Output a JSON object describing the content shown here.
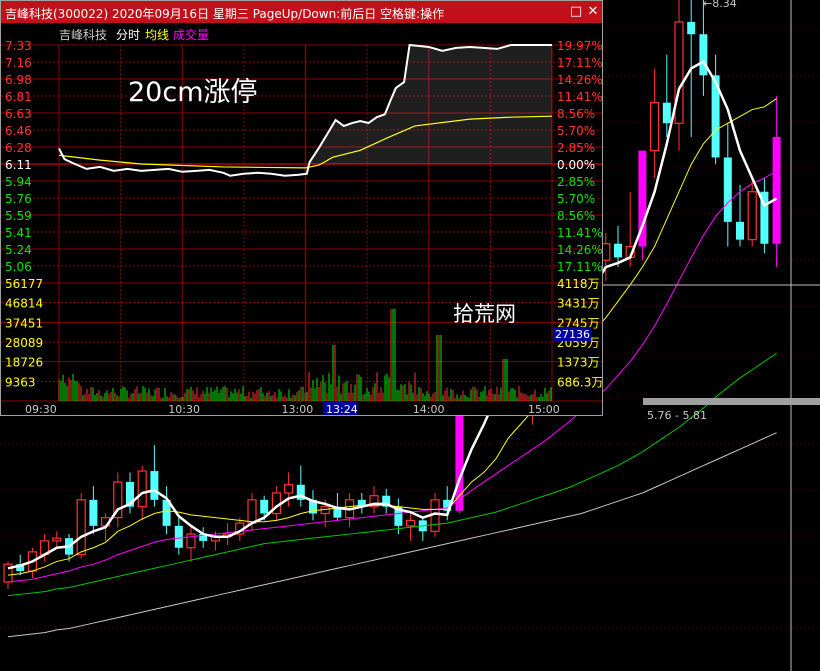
{
  "window": {
    "title": "吉峰科技(300022) 2020年09月16日 星期三 PageUp/Down:前后日 空格键:操作",
    "min_icon": "minimize-icon",
    "close_icon": "close-icon"
  },
  "minute_chart": {
    "stock_name": "吉峰科技",
    "tab_minute": "分时",
    "legend_avg": "均线",
    "legend_vol": "成交量",
    "annotation": "20cm涨停",
    "watermark": "拾荒网",
    "price_labels_up": [
      "7.33",
      "7.16",
      "6.98",
      "6.81",
      "6.63",
      "6.46",
      "6.28"
    ],
    "price_label_mid": "6.11",
    "price_labels_down": [
      "5.94",
      "5.76",
      "5.59",
      "5.41",
      "5.24",
      "5.06"
    ],
    "pct_labels_up": [
      "19.97%",
      "17.11%",
      "14.26%",
      "11.41%",
      "8.56%",
      "5.70%",
      "2.85%"
    ],
    "pct_label_mid": "0.00%",
    "pct_labels_down": [
      "2.85%",
      "5.70%",
      "8.56%",
      "11.41%",
      "14.26%",
      "17.11%"
    ],
    "vol_labels_left": [
      "56177",
      "46814",
      "37451",
      "28089",
      "18726",
      "9363"
    ],
    "vol_labels_right": [
      "4118万",
      "3431万",
      "2745万",
      "2059万",
      "1373万",
      "686.3万"
    ],
    "vol_cursor_value": "27136",
    "time_labels": [
      "09:30",
      "10:30",
      "13:00",
      "14:00",
      "15:00"
    ],
    "cursor_time": "13:24",
    "colors": {
      "up": "#ff3232",
      "down": "#00e600",
      "mid": "#ffffff",
      "price_line": "#ffffff",
      "avg_line": "#ffff00",
      "grid": "#8b0000",
      "cursor_box": "#0000a0"
    },
    "chart_data": {
      "type": "line",
      "prev_close": 6.11,
      "series": [
        {
          "name": "price",
          "points": [
            [
              0,
              6.27
            ],
            [
              4,
              6.16
            ],
            [
              10,
              6.12
            ],
            [
              20,
              6.06
            ],
            [
              30,
              6.08
            ],
            [
              40,
              6.04
            ],
            [
              50,
              6.06
            ],
            [
              60,
              6.04
            ],
            [
              70,
              6.05
            ],
            [
              80,
              6.06
            ],
            [
              90,
              6.03
            ],
            [
              100,
              6.04
            ],
            [
              110,
              6.05
            ],
            [
              120,
              6.02
            ],
            [
              125,
              5.99
            ],
            [
              135,
              6.01
            ],
            [
              145,
              6.02
            ],
            [
              155,
              6.01
            ],
            [
              165,
              5.99
            ],
            [
              175,
              6.0
            ],
            [
              181,
              6.01
            ],
            [
              183,
              6.13
            ],
            [
              190,
              6.28
            ],
            [
              196,
              6.42
            ],
            [
              202,
              6.56
            ],
            [
              208,
              6.5
            ],
            [
              214,
              6.53
            ],
            [
              220,
              6.55
            ],
            [
              226,
              6.53
            ],
            [
              232,
              6.59
            ],
            [
              238,
              6.62
            ],
            [
              242,
              6.76
            ],
            [
              246,
              6.89
            ],
            [
              252,
              6.95
            ],
            [
              256,
              7.33
            ],
            [
              270,
              7.31
            ],
            [
              280,
              7.27
            ],
            [
              290,
              7.3
            ],
            [
              300,
              7.31
            ],
            [
              310,
              7.3
            ],
            [
              320,
              7.29
            ],
            [
              330,
              7.33
            ],
            [
              345,
              7.33
            ],
            [
              360,
              7.33
            ]
          ]
        },
        {
          "name": "avg",
          "points": [
            [
              0,
              6.2
            ],
            [
              30,
              6.15
            ],
            [
              60,
              6.11
            ],
            [
              120,
              6.08
            ],
            [
              180,
              6.07
            ],
            [
              190,
              6.1
            ],
            [
              200,
              6.18
            ],
            [
              220,
              6.25
            ],
            [
              240,
              6.38
            ],
            [
              260,
              6.5
            ],
            [
              300,
              6.57
            ],
            [
              330,
              6.59
            ],
            [
              360,
              6.6
            ]
          ]
        }
      ],
      "ylim": [
        4.89,
        7.33
      ],
      "xlim": [
        0,
        360
      ]
    }
  },
  "kline_chart": {
    "price_cursor_label": "5.76 - 5.81",
    "high_label": "8.34",
    "colors": {
      "up": "#ff3232",
      "down": "#54ffff",
      "limit": "#ff00ff",
      "ma5": "#ffffff",
      "ma10": "#ffff00",
      "ma20": "#ff00ff",
      "ma30": "#00c800",
      "ma60": "#c8c8c8"
    },
    "chart_data": {
      "type": "candlestick",
      "ylim": [
        3.6,
        8.5
      ],
      "candles": [
        [
          4.25,
          4.4,
          4.2,
          4.38
        ],
        [
          4.38,
          4.45,
          4.3,
          4.33
        ],
        [
          4.33,
          4.5,
          4.28,
          4.47
        ],
        [
          4.45,
          4.6,
          4.4,
          4.55
        ],
        [
          4.55,
          4.62,
          4.5,
          4.57
        ],
        [
          4.57,
          4.6,
          4.4,
          4.45
        ],
        [
          4.45,
          4.9,
          4.42,
          4.85
        ],
        [
          4.85,
          4.95,
          4.6,
          4.66
        ],
        [
          4.66,
          4.75,
          4.55,
          4.72
        ],
        [
          4.72,
          5.05,
          4.65,
          4.98
        ],
        [
          4.98,
          5.05,
          4.75,
          4.8
        ],
        [
          4.8,
          5.1,
          4.7,
          5.06
        ],
        [
          5.06,
          5.25,
          4.8,
          4.85
        ],
        [
          4.85,
          4.95,
          4.6,
          4.66
        ],
        [
          4.66,
          4.72,
          4.45,
          4.5
        ],
        [
          4.5,
          4.65,
          4.4,
          4.6
        ],
        [
          4.6,
          4.65,
          4.5,
          4.55
        ],
        [
          4.55,
          4.62,
          4.48,
          4.58
        ],
        [
          4.58,
          4.68,
          4.52,
          4.6
        ],
        [
          4.6,
          4.72,
          4.55,
          4.68
        ],
        [
          4.68,
          4.9,
          4.62,
          4.85
        ],
        [
          4.85,
          4.88,
          4.7,
          4.75
        ],
        [
          4.75,
          4.95,
          4.7,
          4.9
        ],
        [
          4.9,
          5.05,
          4.8,
          4.96
        ],
        [
          4.96,
          5.1,
          4.8,
          4.85
        ],
        [
          4.85,
          4.92,
          4.7,
          4.75
        ],
        [
          4.75,
          4.85,
          4.65,
          4.8
        ],
        [
          4.8,
          4.9,
          4.7,
          4.72
        ],
        [
          4.72,
          4.9,
          4.65,
          4.85
        ],
        [
          4.85,
          4.9,
          4.75,
          4.8
        ],
        [
          4.8,
          4.95,
          4.75,
          4.88
        ],
        [
          4.88,
          4.93,
          4.75,
          4.8
        ],
        [
          4.8,
          4.86,
          4.6,
          4.66
        ],
        [
          4.66,
          4.75,
          4.55,
          4.7
        ],
        [
          4.7,
          4.72,
          4.55,
          4.62
        ],
        [
          4.62,
          4.9,
          4.58,
          4.85
        ],
        [
          4.85,
          4.95,
          4.7,
          4.77
        ],
        [
          4.77,
          5.72,
          4.75,
          5.72
        ],
        [
          5.72,
          6.4,
          5.5,
          5.9
        ],
        [
          5.9,
          6.1,
          5.6,
          5.7
        ],
        [
          5.7,
          6.2,
          5.6,
          6.05
        ],
        [
          6.05,
          6.15,
          5.8,
          5.95
        ],
        [
          5.95,
          6.1,
          5.5,
          5.55
        ],
        [
          5.55,
          5.8,
          5.4,
          5.75
        ],
        [
          5.75,
          6.2,
          5.6,
          6.1
        ],
        [
          6.1,
          6.45,
          5.95,
          6.35
        ],
        [
          6.35,
          6.5,
          6.1,
          6.2
        ],
        [
          6.2,
          6.55,
          6.1,
          6.48
        ],
        [
          6.48,
          6.75,
          6.3,
          6.6
        ],
        [
          6.6,
          6.8,
          6.45,
          6.72
        ],
        [
          6.72,
          6.85,
          6.55,
          6.62
        ],
        [
          6.62,
          7.1,
          6.55,
          6.7
        ],
        [
          6.7,
          7.4,
          6.6,
          7.4
        ],
        [
          7.4,
          8.0,
          7.2,
          7.75
        ],
        [
          7.75,
          8.1,
          7.5,
          7.6
        ],
        [
          7.6,
          8.5,
          7.4,
          8.34
        ],
        [
          8.34,
          8.5,
          7.5,
          8.25
        ],
        [
          8.25,
          8.6,
          7.8,
          7.95
        ],
        [
          7.95,
          8.1,
          7.3,
          7.35
        ],
        [
          7.35,
          7.6,
          6.7,
          6.88
        ],
        [
          6.88,
          7.15,
          6.7,
          6.75
        ],
        [
          6.75,
          7.2,
          6.7,
          7.1
        ],
        [
          7.1,
          7.2,
          6.65,
          6.72
        ],
        [
          6.72,
          7.8,
          6.55,
          7.5
        ]
      ],
      "limit_up_indices": [
        37,
        52,
        63
      ],
      "ma5": [
        4.35,
        4.37,
        4.4,
        4.45,
        4.5,
        4.51,
        4.58,
        4.62,
        4.65,
        4.78,
        4.82,
        4.9,
        4.92,
        4.86,
        4.73,
        4.66,
        4.6,
        4.58,
        4.58,
        4.62,
        4.68,
        4.72,
        4.8,
        4.86,
        4.88,
        4.84,
        4.82,
        4.79,
        4.78,
        4.8,
        4.82,
        4.82,
        4.78,
        4.76,
        4.72,
        4.75,
        4.74,
        5.0,
        5.22,
        5.4,
        5.6,
        5.84,
        5.82,
        5.8,
        5.83,
        5.9,
        6.0,
        6.22,
        6.4,
        6.55,
        6.58,
        6.62,
        6.85,
        7.1,
        7.45,
        7.85,
        8.0,
        8.05,
        7.9,
        7.7,
        7.4,
        7.2,
        7.0,
        7.05
      ],
      "ma10": [
        4.3,
        4.31,
        4.33,
        4.36,
        4.4,
        4.42,
        4.47,
        4.5,
        4.54,
        4.62,
        4.66,
        4.71,
        4.75,
        4.77,
        4.76,
        4.74,
        4.73,
        4.72,
        4.71,
        4.7,
        4.69,
        4.69,
        4.7,
        4.72,
        4.75,
        4.77,
        4.78,
        4.79,
        4.8,
        4.81,
        4.81,
        4.81,
        4.8,
        4.79,
        4.78,
        4.78,
        4.78,
        4.88,
        4.98,
        5.05,
        5.15,
        5.3,
        5.4,
        5.5,
        5.6,
        5.72,
        5.85,
        5.98,
        6.08,
        6.18,
        6.3,
        6.42,
        6.55,
        6.7,
        6.9,
        7.1,
        7.3,
        7.45,
        7.55,
        7.6,
        7.65,
        7.7,
        7.72,
        7.78
      ],
      "ma20": [
        4.25,
        4.26,
        4.27,
        4.29,
        4.31,
        4.33,
        4.36,
        4.38,
        4.41,
        4.45,
        4.48,
        4.51,
        4.54,
        4.56,
        4.57,
        4.58,
        4.59,
        4.6,
        4.61,
        4.62,
        4.63,
        4.64,
        4.65,
        4.66,
        4.67,
        4.68,
        4.69,
        4.7,
        4.71,
        4.72,
        4.73,
        4.74,
        4.75,
        4.76,
        4.77,
        4.78,
        4.79,
        4.85,
        4.92,
        4.98,
        5.04,
        5.1,
        5.16,
        5.22,
        5.28,
        5.35,
        5.42,
        5.5,
        5.58,
        5.66,
        5.76,
        5.86,
        5.98,
        6.12,
        6.28,
        6.45,
        6.62,
        6.78,
        6.92,
        7.02,
        7.1,
        7.16,
        7.2,
        7.25
      ],
      "ma30": [
        4.15,
        4.16,
        4.17,
        4.18,
        4.2,
        4.21,
        4.23,
        4.25,
        4.27,
        4.29,
        4.31,
        4.33,
        4.35,
        4.37,
        4.39,
        4.41,
        4.43,
        4.45,
        4.47,
        4.49,
        4.51,
        4.53,
        4.54,
        4.55,
        4.56,
        4.57,
        4.58,
        4.59,
        4.6,
        4.61,
        4.62,
        4.63,
        4.64,
        4.65,
        4.66,
        4.67,
        4.68,
        4.7,
        4.72,
        4.74,
        4.76,
        4.79,
        4.82,
        4.85,
        4.88,
        4.91,
        4.94,
        4.98,
        5.02,
        5.06,
        5.1,
        5.15,
        5.2,
        5.26,
        5.32,
        5.38,
        5.45,
        5.52,
        5.6,
        5.67,
        5.74,
        5.8,
        5.86,
        5.92
      ],
      "ma60": [
        3.85,
        3.86,
        3.87,
        3.88,
        3.9,
        3.91,
        3.93,
        3.95,
        3.97,
        3.99,
        4.01,
        4.03,
        4.05,
        4.07,
        4.09,
        4.11,
        4.13,
        4.15,
        4.17,
        4.19,
        4.21,
        4.23,
        4.25,
        4.27,
        4.29,
        4.31,
        4.33,
        4.35,
        4.37,
        4.39,
        4.41,
        4.43,
        4.45,
        4.47,
        4.49,
        4.51,
        4.53,
        4.55,
        4.57,
        4.59,
        4.61,
        4.63,
        4.65,
        4.67,
        4.69,
        4.71,
        4.73,
        4.75,
        4.78,
        4.81,
        4.84,
        4.87,
        4.9,
        4.94,
        4.98,
        5.02,
        5.06,
        5.1,
        5.14,
        5.18,
        5.22,
        5.26,
        5.3,
        5.34
      ]
    }
  }
}
